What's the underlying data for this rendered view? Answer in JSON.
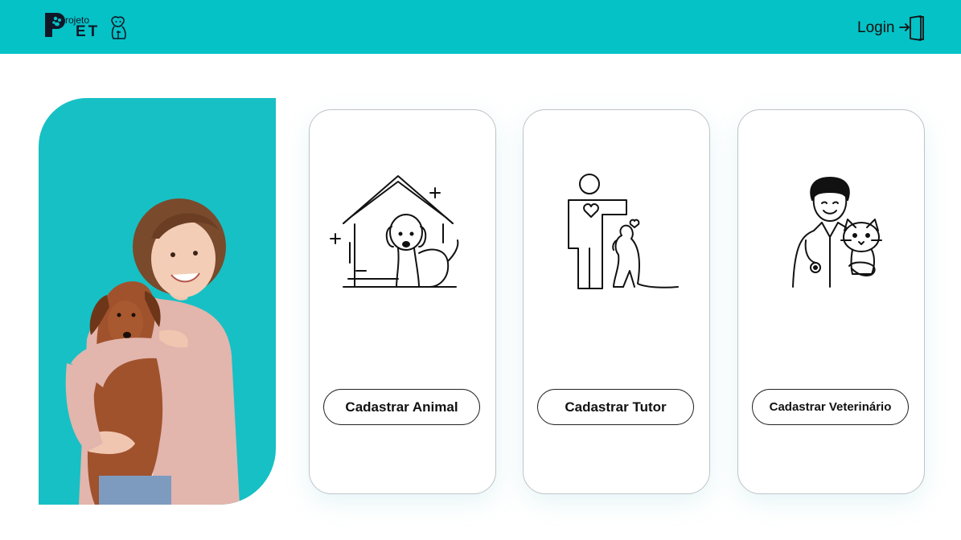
{
  "header": {
    "logo_small": "rojeto",
    "logo_big": "ET",
    "login_label": "Login"
  },
  "cards": [
    {
      "button_label": "Cadastrar Animal",
      "illustration": "dog-house-icon"
    },
    {
      "button_label": "Cadastrar Tutor",
      "illustration": "tutor-with-dog-icon"
    },
    {
      "button_label": "Cadastrar Veterinário",
      "illustration": "veterinarian-with-cat-icon"
    }
  ],
  "hero": {
    "image": "woman-holding-dachshund"
  },
  "colors": {
    "accent": "#05c2c6",
    "hero_bg": "#17c0c4"
  }
}
